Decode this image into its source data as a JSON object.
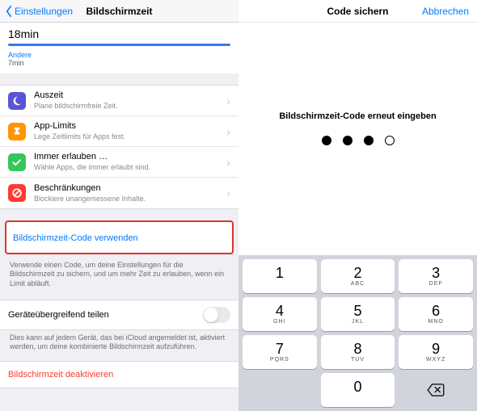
{
  "left": {
    "back_label": "Einstellungen",
    "title": "Bildschirmzeit",
    "current_time_row": "18min",
    "other_label": "Andere",
    "other_value": "7min",
    "menu": [
      {
        "title": "Auszeit",
        "sub": "Plane bildschirmfreie Zeit.",
        "color": "#5755d5",
        "icon": "moon-icon"
      },
      {
        "title": "App-Limits",
        "sub": "Lege Zeitlimits für Apps fest.",
        "color": "#ff9500",
        "icon": "hourglass-icon"
      },
      {
        "title": "Immer erlauben …",
        "sub": "Wähle Apps, die immer erlaubt sind.",
        "color": "#34c759",
        "icon": "check-icon"
      },
      {
        "title": "Beschränkungen",
        "sub": "Blockiere unangemessene Inhalte.",
        "color": "#ff3b30",
        "icon": "nosign-icon"
      }
    ],
    "code_button": "Bildschirmzeit-Code verwenden",
    "code_footer": "Verwende einen Code, um deine Einstellungen für die Bildschirmzeit zu sichern, und um mehr Zeit zu erlauben, wenn ein Limit abläuft.",
    "share_label": "Geräteübergreifend teilen",
    "share_footer": "Dies kann auf jedem Gerät, das bei iCloud angemeldet ist, aktiviert werden, um deine kombinierte Bildschirmzeit aufzuführen.",
    "deactivate": "Bildschirmzeit deaktivieren"
  },
  "right": {
    "title": "Code sichern",
    "cancel": "Abbrechen",
    "prompt": "Bildschirmzeit-Code erneut eingeben",
    "entered": 3,
    "total": 4,
    "keys": [
      {
        "n": "1",
        "l": ""
      },
      {
        "n": "2",
        "l": "ABC"
      },
      {
        "n": "3",
        "l": "DEF"
      },
      {
        "n": "4",
        "l": "GHI"
      },
      {
        "n": "5",
        "l": "JKL"
      },
      {
        "n": "6",
        "l": "MNO"
      },
      {
        "n": "7",
        "l": "PQRS"
      },
      {
        "n": "8",
        "l": "TUV"
      },
      {
        "n": "9",
        "l": "WXYZ"
      },
      {
        "n": "",
        "l": "",
        "blank": true
      },
      {
        "n": "0",
        "l": ""
      },
      {
        "n": "",
        "l": "",
        "del": true
      }
    ]
  }
}
